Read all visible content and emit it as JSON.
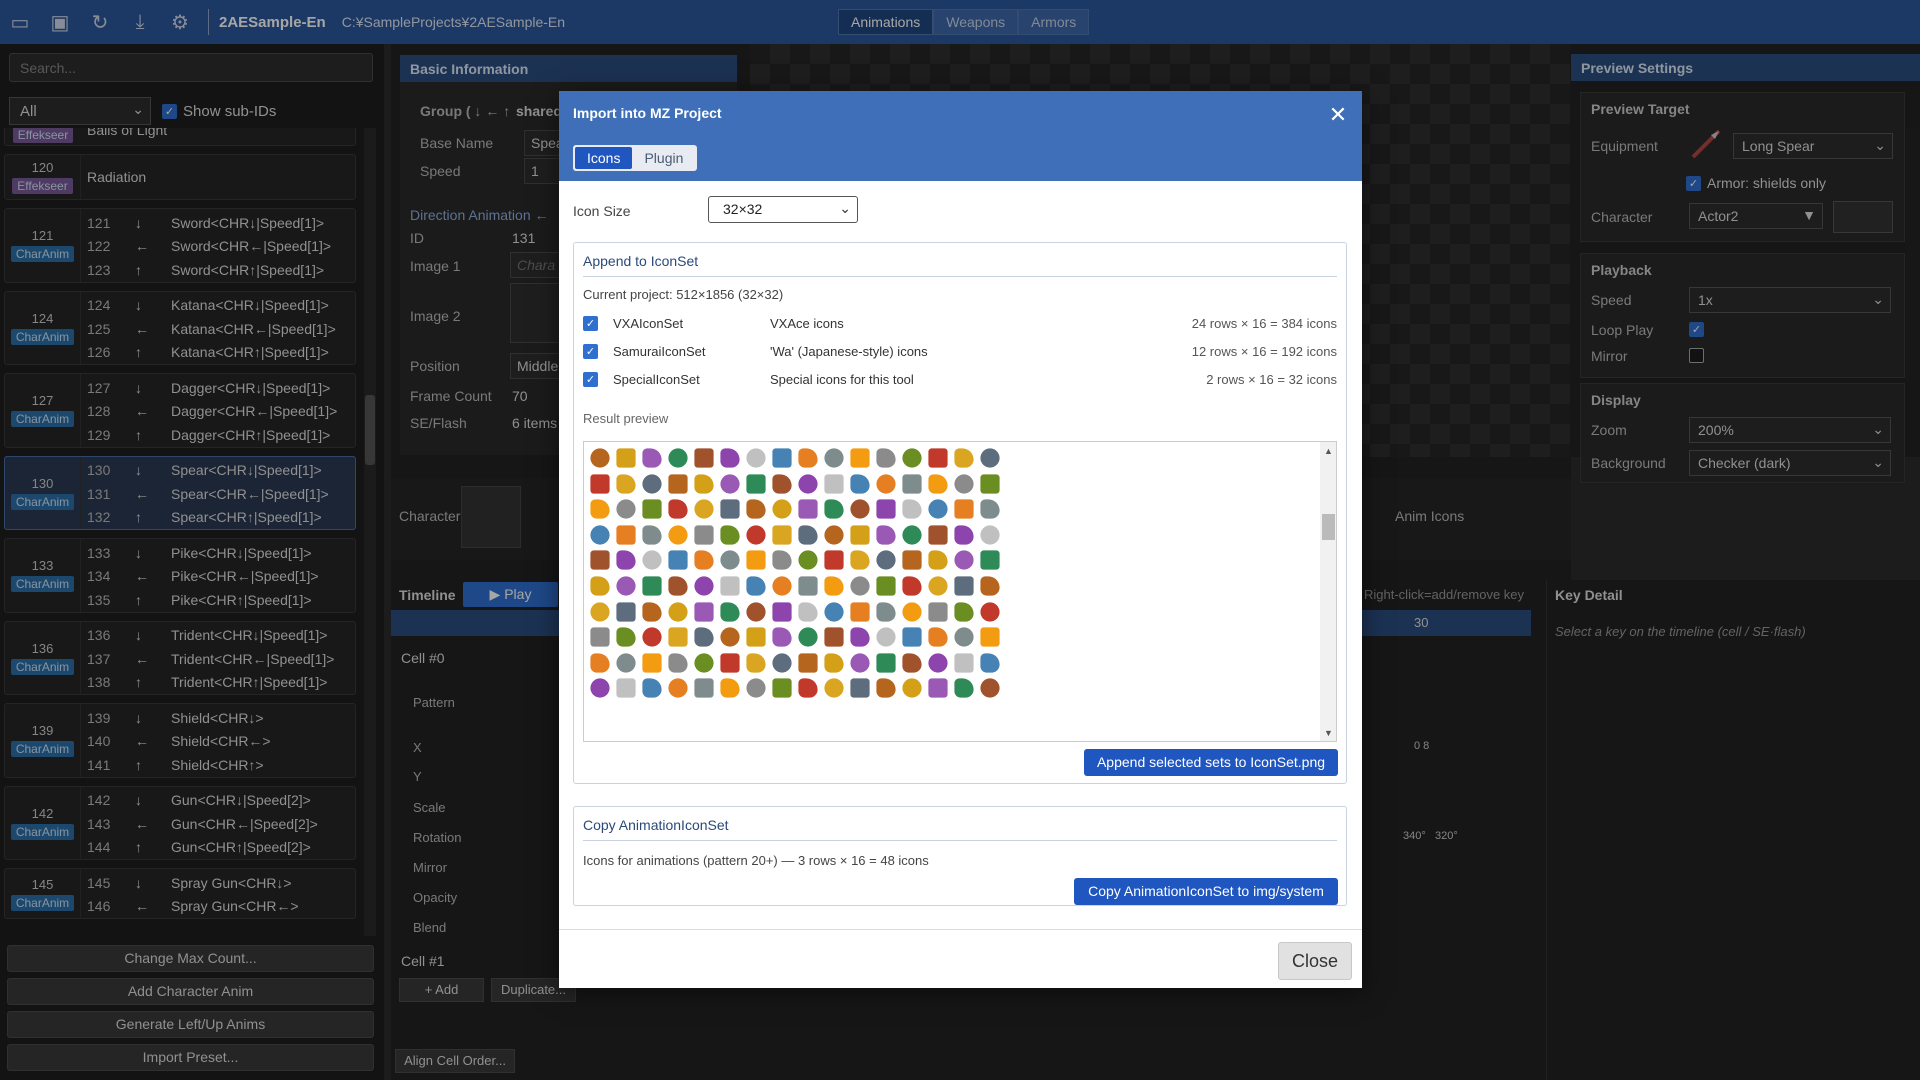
{
  "topbar": {
    "title": "2AESample-En",
    "path": "C:¥SampleProjects¥2AESample-En",
    "tabs": [
      "Animations",
      "Weapons",
      "Armors"
    ],
    "active_tab": "Animations"
  },
  "left": {
    "search_placeholder": "Search...",
    "filter": "All",
    "show_sub_ids": "Show sub-IDs",
    "partial_top": "Balls of Light",
    "radiation_id": "120",
    "radiation_badge": "Effekseer",
    "radiation_label": "Radiation",
    "groups": [
      {
        "id": "121",
        "badge": "CharAnim",
        "rows": [
          [
            "121",
            "↓",
            "Sword<CHR↓|Speed[1]>"
          ],
          [
            "122",
            "←",
            "Sword<CHR←|Speed[1]>"
          ],
          [
            "123",
            "↑",
            "Sword<CHR↑|Speed[1]>"
          ]
        ]
      },
      {
        "id": "124",
        "badge": "CharAnim",
        "rows": [
          [
            "124",
            "↓",
            "Katana<CHR↓|Speed[1]>"
          ],
          [
            "125",
            "←",
            "Katana<CHR←|Speed[1]>"
          ],
          [
            "126",
            "↑",
            "Katana<CHR↑|Speed[1]>"
          ]
        ]
      },
      {
        "id": "127",
        "badge": "CharAnim",
        "rows": [
          [
            "127",
            "↓",
            "Dagger<CHR↓|Speed[1]>"
          ],
          [
            "128",
            "←",
            "Dagger<CHR←|Speed[1]>"
          ],
          [
            "129",
            "↑",
            "Dagger<CHR↑|Speed[1]>"
          ]
        ]
      },
      {
        "id": "130",
        "badge": "CharAnim",
        "rows": [
          [
            "130",
            "↓",
            "Spear<CHR↓|Speed[1]>"
          ],
          [
            "131",
            "←",
            "Spear<CHR←|Speed[1]>"
          ],
          [
            "132",
            "↑",
            "Spear<CHR↑|Speed[1]>"
          ]
        ]
      },
      {
        "id": "133",
        "badge": "CharAnim",
        "rows": [
          [
            "133",
            "↓",
            "Pike<CHR↓|Speed[1]>"
          ],
          [
            "134",
            "←",
            "Pike<CHR←|Speed[1]>"
          ],
          [
            "135",
            "↑",
            "Pike<CHR↑|Speed[1]>"
          ]
        ]
      },
      {
        "id": "136",
        "badge": "CharAnim",
        "rows": [
          [
            "136",
            "↓",
            "Trident<CHR↓|Speed[1]>"
          ],
          [
            "137",
            "←",
            "Trident<CHR←|Speed[1]>"
          ],
          [
            "138",
            "↑",
            "Trident<CHR↑|Speed[1]>"
          ]
        ]
      },
      {
        "id": "139",
        "badge": "CharAnim",
        "rows": [
          [
            "139",
            "↓",
            "Shield<CHR↓>"
          ],
          [
            "140",
            "←",
            "Shield<CHR←>"
          ],
          [
            "141",
            "↑",
            "Shield<CHR↑>"
          ]
        ]
      },
      {
        "id": "142",
        "badge": "CharAnim",
        "rows": [
          [
            "142",
            "↓",
            "Gun<CHR↓|Speed[2]>"
          ],
          [
            "143",
            "←",
            "Gun<CHR←|Speed[2]>"
          ],
          [
            "144",
            "↑",
            "Gun<CHR↑|Speed[2]>"
          ]
        ]
      },
      {
        "id": "145",
        "badge": "CharAnim",
        "rows": [
          [
            "145",
            "↓",
            "Spray Gun<CHR↓>"
          ],
          [
            "146",
            "←",
            "Spray Gun<CHR←>"
          ]
        ]
      }
    ],
    "buttons": [
      "Change Max Count...",
      "Add Character Anim",
      "Generate Left/Up Anims",
      "Import Preset..."
    ]
  },
  "basic": {
    "title": "Basic Information",
    "group_label": "Group ( ↓ ← ↑",
    "group_value": "shared",
    "base_name_label": "Base Name",
    "base_name_value": "Spear",
    "speed_label": "Speed",
    "speed_value": "1",
    "dir_anim_label": "Direction Animation ←",
    "id_label": "ID",
    "id_value": "131",
    "image1_label": "Image 1",
    "image1_value": "Chara",
    "image2_label": "Image 2",
    "position_label": "Position",
    "position_value": "Middle",
    "frame_count_label": "Frame Count",
    "frame_count_value": "70",
    "se_flash_label": "SE/Flash",
    "se_flash_value": "6 items"
  },
  "preview": {
    "title": "Preview Settings",
    "target_label": "Preview Target",
    "equipment_label": "Equipment",
    "equipment_value": "Long Spear",
    "armor_label": "Armor: shields only",
    "character_label": "Character",
    "character_value": "Actor2",
    "playback_label": "Playback",
    "speed_label": "Speed",
    "speed_value": "1x",
    "loop_label": "Loop Play",
    "mirror_label": "Mirror",
    "display_label": "Display",
    "zoom_label": "Zoom",
    "zoom_value": "200%",
    "background_label": "Background",
    "background_value": "Checker (dark)"
  },
  "strip": {
    "character_label": "Character",
    "anim_icons_label": "Anim Icons"
  },
  "timeline": {
    "title": "Timeline",
    "play": "▶ Play",
    "hint": "Right-click=add/remove key",
    "frame_marker": "30",
    "cell0": "Cell #0",
    "cell1": "Cell #1",
    "props": [
      "Pattern",
      "X",
      "Y",
      "Scale",
      "Rotation",
      "Mirror",
      "Opacity",
      "Blend"
    ],
    "add": "+ Add",
    "duplicate": "Duplicate...",
    "align": "Align Cell Order...",
    "key_x": "0 8",
    "key_rot_a": "340°",
    "key_rot_b": "320°"
  },
  "keydetail": {
    "title": "Key Detail",
    "hint": "Select a key on the timeline (cell / SE·flash)"
  },
  "dialog": {
    "title": "Import into MZ Project",
    "tabs": [
      "Icons",
      "Plugin"
    ],
    "icon_size_label": "Icon Size",
    "icon_size_value": "32×32",
    "append_title": "Append to IconSet",
    "current_project": "Current project: 512×1856 (32×32)",
    "sets": [
      {
        "name": "VXAIconSet",
        "desc": "VXAce icons",
        "count": "24 rows × 16 = 384 icons"
      },
      {
        "name": "SamuraiIconSet",
        "desc": "'Wa' (Japanese-style) icons",
        "count": "12 rows × 16 = 192 icons"
      },
      {
        "name": "SpecialIconSet",
        "desc": "Special icons for this tool",
        "count": "2 rows × 16 = 32 icons"
      }
    ],
    "result_preview": "Result preview",
    "append_button": "Append selected sets to IconSet.png",
    "copy_title": "Copy AnimationIconSet",
    "copy_text": "Icons for animations (pattern 20+) — 3 rows × 16 = 48 icons",
    "copy_button": "Copy AnimationIconSet to img/system",
    "close_button": "Close"
  },
  "colors": {
    "accent": "#2b579a",
    "dialog_header": "#3e6fb8",
    "primary_button": "#1f56c0"
  }
}
